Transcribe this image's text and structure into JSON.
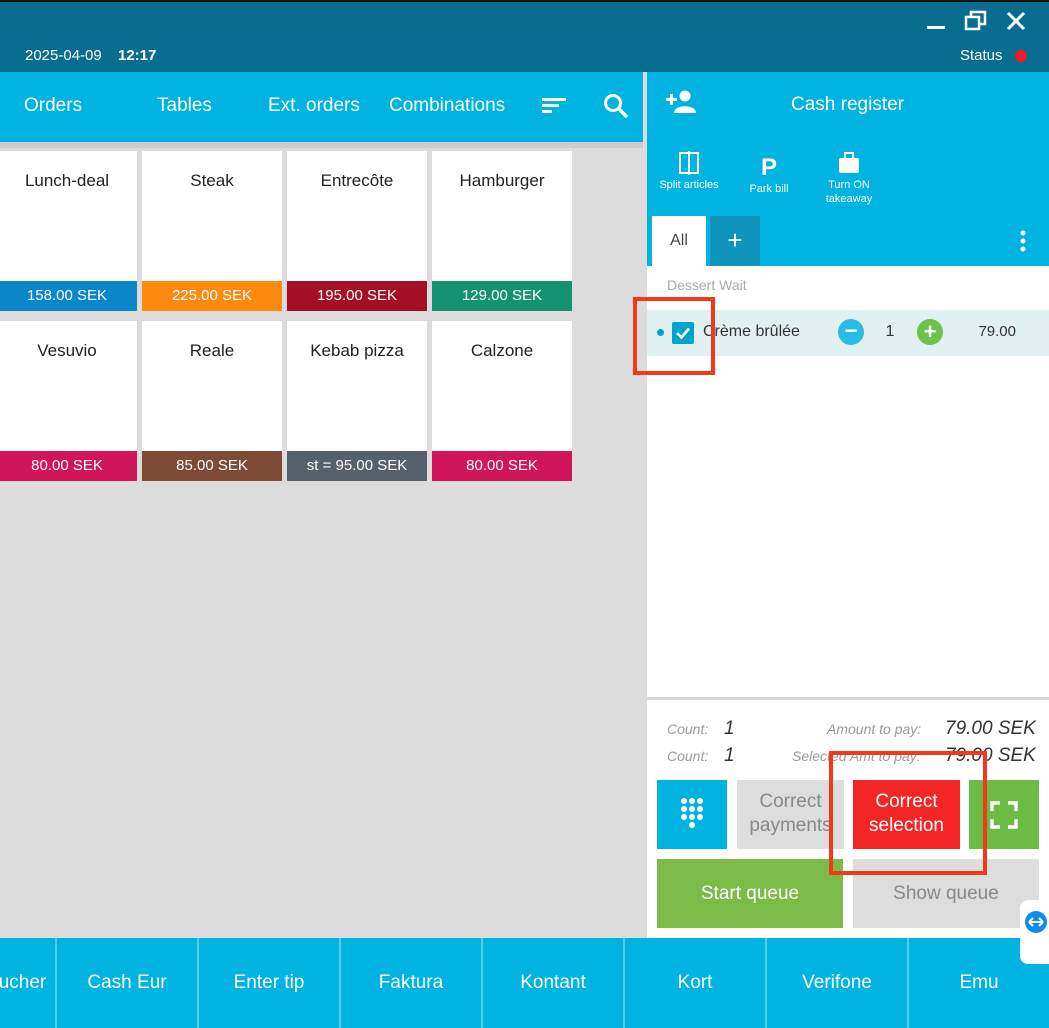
{
  "window": {
    "date": "2025-04-09",
    "time": "12:17",
    "status_label": "Status",
    "status_color": "#ee1c24"
  },
  "nav": {
    "items": [
      "Orders",
      "Tables",
      "Ext. orders",
      "Combinations"
    ]
  },
  "products": [
    {
      "name": "Lunch-deal",
      "price": "158.00 SEK",
      "color": "#0a86c9"
    },
    {
      "name": "Steak",
      "price": "225.00 SEK",
      "color": "#fb8a0f"
    },
    {
      "name": "Entrecôte",
      "price": "195.00 SEK",
      "color": "#a50f26"
    },
    {
      "name": "Hamburger",
      "price": "129.00 SEK",
      "color": "#159270"
    },
    {
      "name": "Vesuvio",
      "price": "80.00 SEK",
      "color": "#d0155a"
    },
    {
      "name": "Reale",
      "price": "85.00 SEK",
      "color": "#7d4a35"
    },
    {
      "name": "Kebab pizza",
      "price": "st = 95.00 SEK",
      "color": "#56606a"
    },
    {
      "name": "Calzone",
      "price": "80.00 SEK",
      "color": "#d0155a"
    }
  ],
  "register": {
    "title": "Cash register",
    "tools": {
      "split": "Split articles",
      "park": "Park bill",
      "takeaway": "Turn ON takeaway"
    },
    "tab_all": "All",
    "tab_add": "+",
    "course": "Dessert Wait",
    "item": {
      "name": "Crème brûlée",
      "qty": "1",
      "price": "79.00"
    },
    "summary": {
      "count_label": "Count:",
      "count": "1",
      "amount_label": "Amount to pay:",
      "amount": "79.00 SEK",
      "count2_label": "Count:",
      "count2": "1",
      "selected_label": "Selected Amt to pay:",
      "selected": "79.00 SEK"
    },
    "buttons": {
      "correct_payments": "Correct payments",
      "correct_selection": "Correct selection",
      "start_queue": "Start queue",
      "show_queue": "Show queue"
    }
  },
  "payments": [
    "ucher",
    "Cash Eur",
    "Enter tip",
    "Faktura",
    "Kontant",
    "Kort",
    "Verifone",
    "Emu"
  ]
}
